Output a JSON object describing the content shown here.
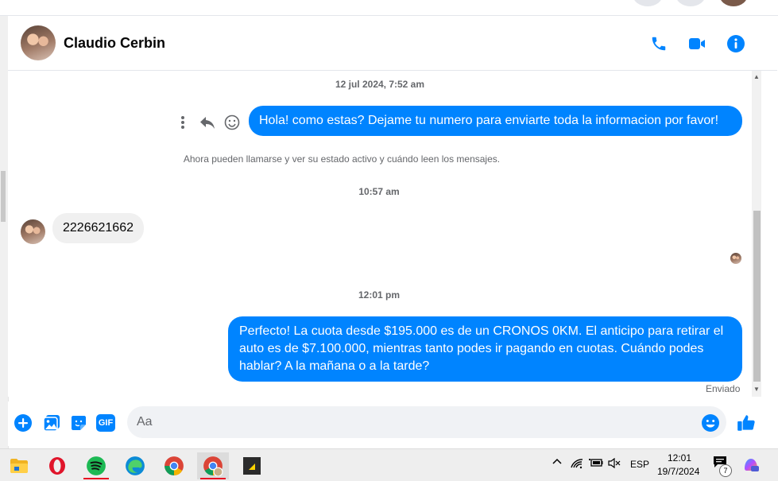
{
  "header": {
    "contact_name": "Claudio Cerbin"
  },
  "messages": {
    "timestamp_1": "12 jul 2024, 7:52 am",
    "outgoing_1": "Hola! como estas? Dejame tu numero para enviarte toda la informacion por favor!",
    "system_note": "Ahora pueden llamarse y ver su estado activo y cuándo leen los mensajes.",
    "timestamp_2": "10:57 am",
    "incoming_1": "2226621662",
    "timestamp_3": "12:01 pm",
    "outgoing_2": "Perfecto! La cuota desde $195.000 es de un CRONOS 0KM. El anticipo para retirar el auto es de $7.100.000, mientras tanto podes ir pagando en cuotas. Cuándo podes hablar? A la mañana o a la tarde?",
    "status": "Enviado"
  },
  "composer": {
    "placeholder": "Aa",
    "value": "",
    "gif_label": "GIF"
  },
  "taskbar": {
    "language": "ESP",
    "time": "12:01",
    "date": "19/7/2024",
    "notification_count": "7",
    "apps": [
      "file-explorer",
      "opera",
      "spotify",
      "edge",
      "chrome",
      "chrome-profile",
      "sticky-notes"
    ]
  },
  "colors": {
    "accent": "#0084ff",
    "incoming_bubble": "#f0f0f0",
    "muted_text": "#65676b"
  }
}
